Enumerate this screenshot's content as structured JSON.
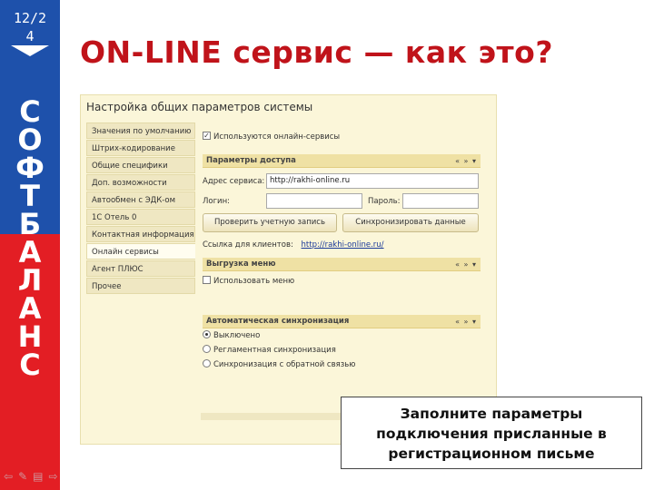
{
  "slide": {
    "number": "12/2\n4",
    "title": "ON-LINE сервис — как это?",
    "brand_letters": [
      "С",
      "О",
      "Ф",
      "Т",
      "Б",
      "А",
      "Л",
      "А",
      "Н",
      "С"
    ],
    "colors": {
      "brand_blue": "#1e51ab",
      "brand_red": "#e31e24",
      "title_red": "#c0131a"
    },
    "nav_icons": [
      "back-arrow-icon",
      "pen-icon",
      "menu-icon",
      "forward-arrow-icon"
    ]
  },
  "window": {
    "title": "Настройка общих параметров системы",
    "sidebar": [
      {
        "label": "Значения по умолчанию",
        "active": false
      },
      {
        "label": "Штрих-кодирование",
        "active": false
      },
      {
        "label": "Общие специфики",
        "active": false
      },
      {
        "label": "Доп. возможности",
        "active": false
      },
      {
        "label": "Автообмен с ЭДК-ом",
        "active": false
      },
      {
        "label": "1С Отель 0",
        "active": false
      },
      {
        "label": "Контактная информация",
        "active": false
      },
      {
        "label": "Онлайн сервисы",
        "active": true
      },
      {
        "label": "Агент ПЛЮС",
        "active": false
      },
      {
        "label": "Прочее",
        "active": false
      }
    ],
    "use_online_label": "Используются онлайн-сервисы",
    "access_section": {
      "title": "Параметры доступа",
      "controls": "« » ▾"
    },
    "service_address_label": "Адрес сервиса:",
    "service_address_value": "http://rakhi-online.ru",
    "login_label": "Логин:",
    "login_value": "",
    "password_label": "Пароль:",
    "password_value": "",
    "check_button": "Проверить учетную запись",
    "sync_button": "Синхронизировать данные",
    "client_link_label": "Ссылка для клиентов:",
    "client_link_value": "http://rakhi-online.ru/",
    "menu_section": {
      "title": "Выгрузка меню",
      "controls": "« » ▾"
    },
    "use_menu_label": "Использовать меню",
    "auto_sync_section": {
      "title": "Автоматическая синхронизация",
      "controls": "« » ▾"
    },
    "radios": [
      {
        "label": "Выключено",
        "selected": true
      },
      {
        "label": "Регламентная синхронизация",
        "selected": false
      },
      {
        "label": "Синхронизация с обратной связью",
        "selected": false
      }
    ]
  },
  "callout": {
    "line1": "Заполните параметры",
    "line2": "подключения присланные в",
    "line3": "регистрационном письме"
  }
}
